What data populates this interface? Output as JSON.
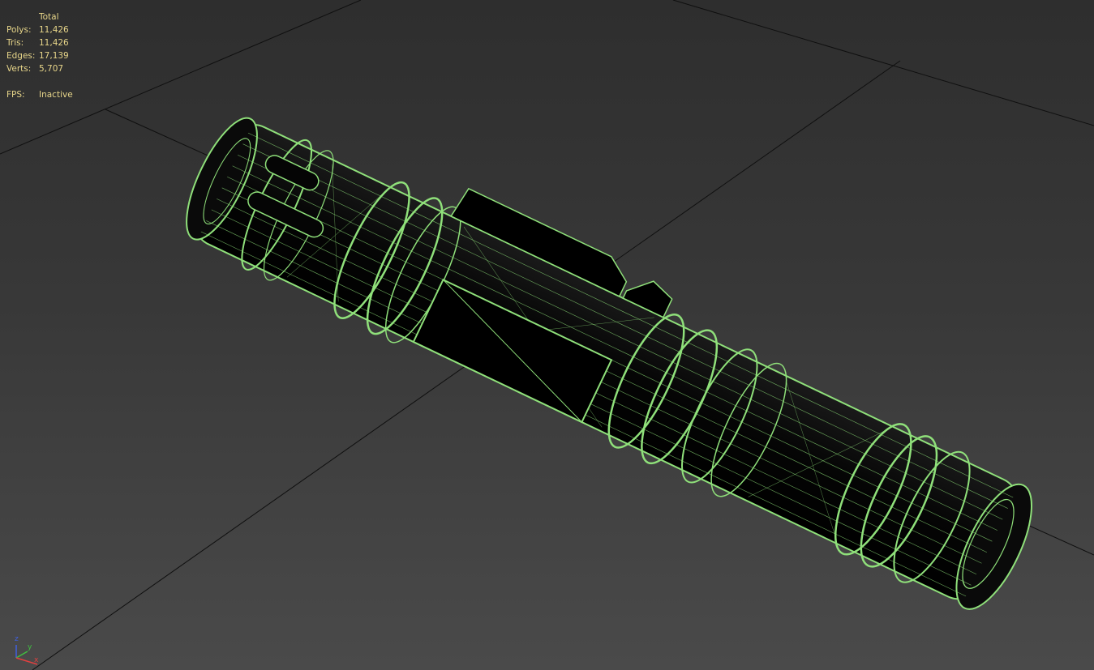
{
  "stats": {
    "header": "Total",
    "rows": [
      {
        "label": "Polys:",
        "value": "11,426"
      },
      {
        "label": "Tris:",
        "value": "11,426"
      },
      {
        "label": "Edges:",
        "value": "17,139"
      },
      {
        "label": "Verts:",
        "value": "5,707"
      }
    ],
    "fps": {
      "label": "FPS:",
      "value": "Inactive"
    }
  },
  "axis_labels": {
    "z": "z",
    "y": "y",
    "x": "x"
  },
  "colors": {
    "wire": "#8fe07a",
    "stats_text": "#e8d68a",
    "grid_line": "#0f0f0f",
    "axis_x": "#e04040",
    "axis_y": "#40c040",
    "axis_z": "#4060e0"
  }
}
